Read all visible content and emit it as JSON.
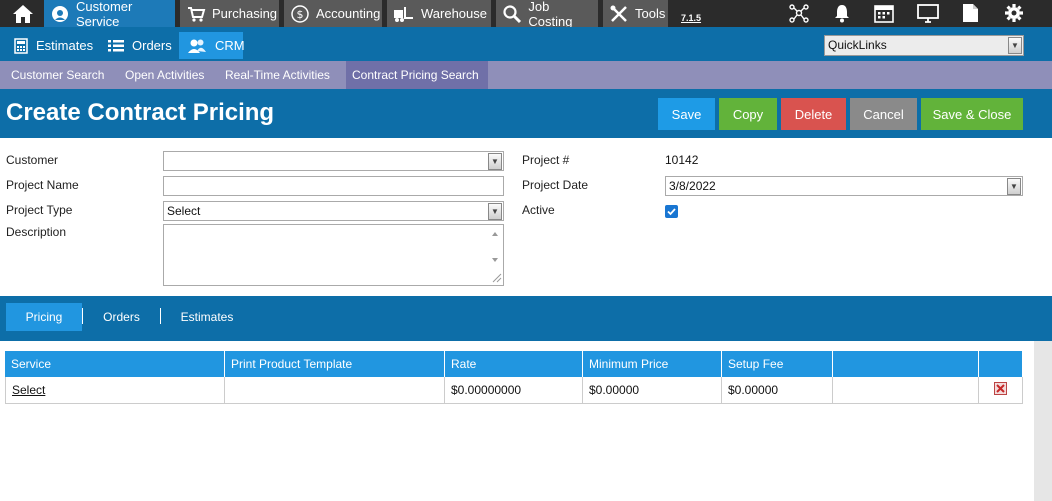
{
  "topbar": {
    "modules": [
      {
        "label": "Customer Service",
        "icon": "headset-icon"
      },
      {
        "label": "Purchasing",
        "icon": "cart-icon"
      },
      {
        "label": "Accounting",
        "icon": "dollar-icon"
      },
      {
        "label": "Warehouse",
        "icon": "forklift-icon"
      },
      {
        "label": "Job Costing",
        "icon": "magnifier-icon"
      },
      {
        "label": "Tools",
        "icon": "tools-icon"
      }
    ],
    "version": "7.1.5"
  },
  "subnav": {
    "items": [
      {
        "label": "Estimates",
        "icon": "calculator-icon"
      },
      {
        "label": "Orders",
        "icon": "list-icon"
      },
      {
        "label": "CRM",
        "icon": "people-icon"
      }
    ],
    "quicklinks_value": "QuickLinks"
  },
  "tabs3": [
    "Customer Search",
    "Open Activities",
    "Real-Time Activities",
    "Contract Pricing Search"
  ],
  "page": {
    "title": "Create Contract Pricing",
    "buttons": {
      "save": "Save",
      "copy": "Copy",
      "delete": "Delete",
      "cancel": "Cancel",
      "save_close": "Save & Close"
    }
  },
  "form": {
    "customer_label": "Customer",
    "customer_value": "",
    "project_name_label": "Project Name",
    "project_name_value": "",
    "project_type_label": "Project Type",
    "project_type_value": "Select",
    "description_label": "Description",
    "project_num_label": "Project #",
    "project_num_value": "10142",
    "project_date_label": "Project Date",
    "project_date_value": "3/8/2022",
    "active_label": "Active",
    "active_checked": true
  },
  "section_tabs": [
    "Pricing",
    "Orders",
    "Estimates"
  ],
  "grid": {
    "headers": [
      "Service",
      "Print Product Template",
      "Rate",
      "Minimum Price",
      "Setup Fee",
      "",
      ""
    ],
    "rows": [
      {
        "service": "Select",
        "template": "",
        "rate": "$0.00000000",
        "min_price": "$0.00000",
        "setup_fee": "$0.00000"
      }
    ]
  },
  "colors": {
    "topbar": "#2b2b2b",
    "primary": "#0d6ea8",
    "accent": "#2196e0",
    "tabs_bar": "#8f8fb9",
    "save": "#1e9be6",
    "copy": "#62b33a",
    "delete": "#d9534f",
    "cancel": "#8a8a8a",
    "save_close": "#62b33a"
  }
}
